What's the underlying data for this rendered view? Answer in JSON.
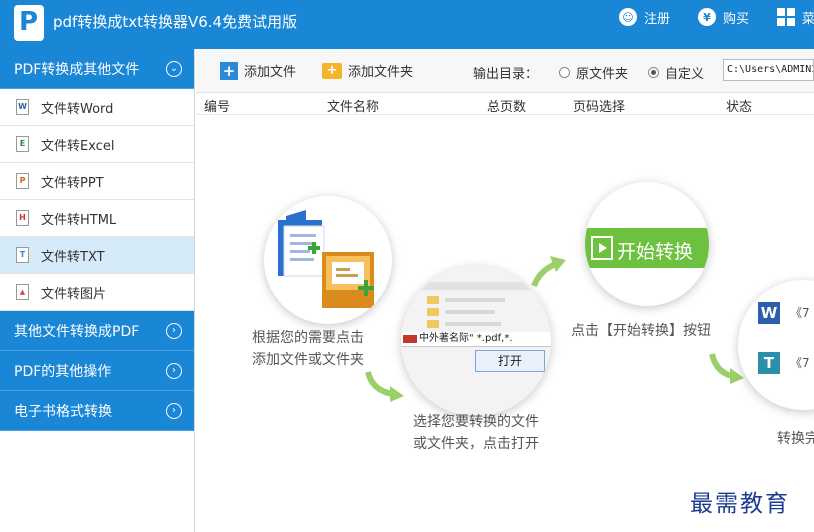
{
  "app": {
    "title": "pdf转换成txt转换器V6.4免费试用版",
    "logo_letter": "P",
    "accent_color": "#1a87d6"
  },
  "titlebar": {
    "register_label": "注册",
    "register_icon": "user-icon",
    "buy_label": "购买",
    "buy_icon": "yen-icon",
    "menu_label": "菜",
    "menu_icon": "grid-icon"
  },
  "sidebar": {
    "categories": [
      {
        "label": "PDF转换成其他文件",
        "expanded": true,
        "items": [
          {
            "label": "文件转Word",
            "icon": "word-doc-icon",
            "glyph": "W",
            "color": "#2b5fad"
          },
          {
            "label": "文件转Excel",
            "icon": "excel-doc-icon",
            "glyph": "E",
            "color": "#2a8a3c"
          },
          {
            "label": "文件转PPT",
            "icon": "ppt-doc-icon",
            "glyph": "P",
            "color": "#d0632a"
          },
          {
            "label": "文件转HTML",
            "icon": "html-doc-icon",
            "glyph": "H",
            "color": "#c0392b"
          },
          {
            "label": "文件转TXT",
            "icon": "txt-doc-icon",
            "glyph": "T",
            "color": "#2b8ad8",
            "active": true
          },
          {
            "label": "文件转图片",
            "icon": "image-doc-icon",
            "glyph": "▲",
            "color": "#d04a4a"
          }
        ]
      },
      {
        "label": "其他文件转换成PDF",
        "expanded": false
      },
      {
        "label": "PDF的其他操作",
        "expanded": false
      },
      {
        "label": "电子书格式转换",
        "expanded": false
      }
    ]
  },
  "toolbar": {
    "add_file_label": "添加文件",
    "add_folder_label": "添加文件夹",
    "output_dir_label": "输出目录：",
    "radio_original_label": "原文件夹",
    "radio_custom_label": "自定义",
    "selected_output": "自定义",
    "output_path": "C:\\Users\\ADMINI"
  },
  "table": {
    "columns": [
      "编号",
      "文件名称",
      "总页数",
      "页码选择",
      "状态"
    ]
  },
  "illustration": {
    "step1_text": [
      "根据您的需要点击",
      "添加文件或文件夹"
    ],
    "step2_text": [
      "选择您要转换的文件",
      "或文件夹，点击打开"
    ],
    "step2_filename": "中外著名际\" *.pdf,*.",
    "step2_open_button": "打开",
    "step3_button": "开始转换",
    "step3_text": "点击【开始转换】按钮",
    "step4_partial_text": "转换完",
    "step4_rows": [
      "《7",
      "《7"
    ],
    "arrow_color": "#9ad06a",
    "highlight_green": "#6cc13f"
  },
  "watermark": "最需教育"
}
